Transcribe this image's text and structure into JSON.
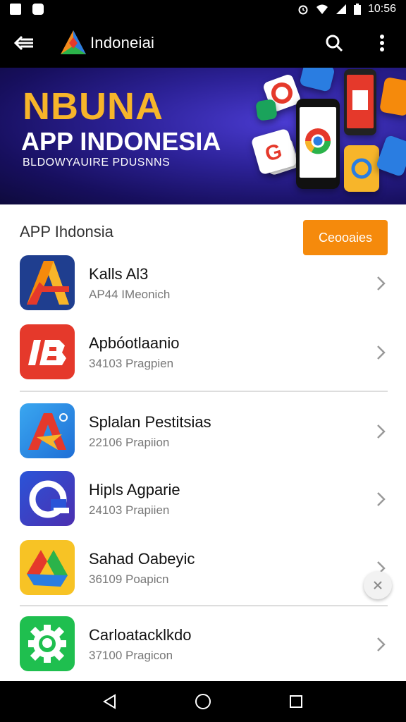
{
  "status_bar": {
    "time": "10:56"
  },
  "app_bar": {
    "title": "Indoneiai"
  },
  "banner": {
    "title": "NBUNA",
    "subtitle": "APP INDONESIA",
    "tagline": "BLDOWYAUIRE PDUSNNS"
  },
  "section": {
    "title": "APP Ihdonsia",
    "button_label": "Ceooaies"
  },
  "apps": [
    {
      "name": "Kalls Al3",
      "meta": "AP44 IMeonich",
      "icon": "arrow-a-icon"
    },
    {
      "name": "Apbóotlaanio",
      "meta": "34103 Pragpien",
      "icon": "lb-icon"
    },
    {
      "name": "Splalan Pestitsias",
      "meta": "22106 Prapiion",
      "icon": "triangle-a-icon"
    },
    {
      "name": "Hipls Agparie",
      "meta": "24103 Prapiien",
      "icon": "at-icon"
    },
    {
      "name": "Sahad Oabeyic",
      "meta": "36109 Poapicn",
      "icon": "drive-icon"
    },
    {
      "name": "Carloatacklkdo",
      "meta": "37100 Pragicon",
      "icon": "gear-icon"
    }
  ],
  "colors": {
    "accent": "#f58a0c",
    "banner_title": "#f7b52a",
    "bar": "#000000"
  }
}
